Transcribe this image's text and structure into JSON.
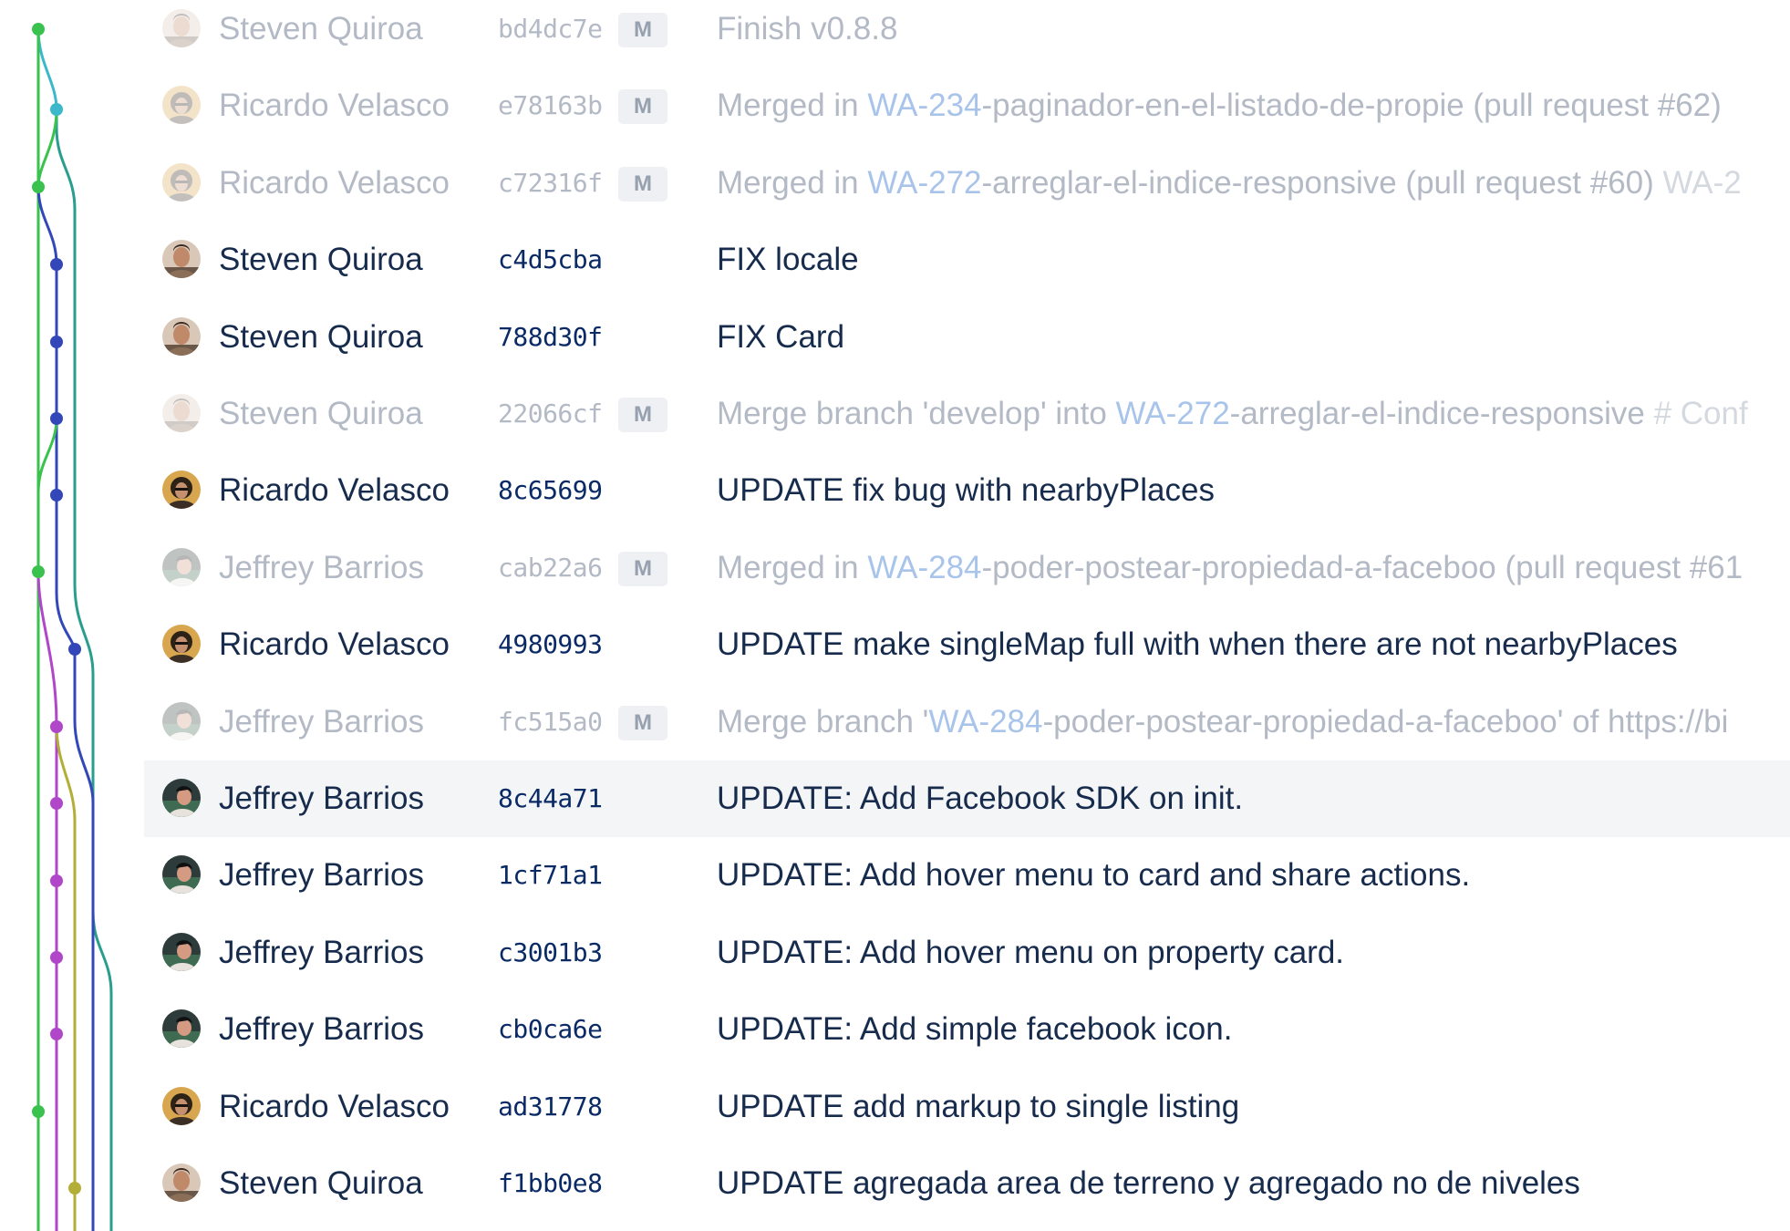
{
  "colors": {
    "lane_green": "#3ac24e",
    "lane_cyan": "#3bb8c9",
    "lane_teal": "#2a9d8f",
    "lane_navy": "#3347b8",
    "lane_magenta": "#b046c8",
    "lane_olive": "#b3ae38",
    "text_primary": "#172b4d",
    "link": "#0052cc"
  },
  "commits": [
    {
      "author": "Steven Quiroa",
      "hash": "bd4dc7e",
      "merge": true,
      "badge": "M",
      "avatar_person": "steven",
      "message": {
        "pre": "Finish v0.8.8",
        "issue": "",
        "post": "",
        "note": ""
      }
    },
    {
      "author": "Ricardo Velasco",
      "hash": "e78163b",
      "merge": true,
      "badge": "M",
      "avatar_person": "ricardo",
      "message": {
        "pre": "Merged in ",
        "issue": "WA-234",
        "post": "-paginador-en-el-listado-de-propie (pull request #62) ",
        "note": ""
      }
    },
    {
      "author": "Ricardo Velasco",
      "hash": "c72316f",
      "merge": true,
      "badge": "M",
      "avatar_person": "ricardo",
      "message": {
        "pre": "Merged in ",
        "issue": "WA-272",
        "post": "-arreglar-el-indice-responsive (pull request #60) ",
        "note": "WA-2"
      }
    },
    {
      "author": "Steven Quiroa",
      "hash": "c4d5cba",
      "merge": false,
      "badge": "",
      "avatar_person": "steven",
      "message": {
        "pre": "FIX locale",
        "issue": "",
        "post": "",
        "note": ""
      }
    },
    {
      "author": "Steven Quiroa",
      "hash": "788d30f",
      "merge": false,
      "badge": "",
      "avatar_person": "steven",
      "message": {
        "pre": "FIX Card",
        "issue": "",
        "post": "",
        "note": ""
      }
    },
    {
      "author": "Steven Quiroa",
      "hash": "22066cf",
      "merge": true,
      "badge": "M",
      "avatar_person": "steven",
      "message": {
        "pre": "Merge branch 'develop' into ",
        "issue": "WA-272",
        "post": "-arreglar-el-indice-responsive ",
        "note": "# Conf"
      }
    },
    {
      "author": "Ricardo Velasco",
      "hash": "8c65699",
      "merge": false,
      "badge": "",
      "avatar_person": "ricardo",
      "message": {
        "pre": "UPDATE fix bug with nearbyPlaces",
        "issue": "",
        "post": "",
        "note": ""
      }
    },
    {
      "author": "Jeffrey Barrios",
      "hash": "cab22a6",
      "merge": true,
      "badge": "M",
      "avatar_person": "jeffrey",
      "message": {
        "pre": "Merged in ",
        "issue": "WA-284",
        "post": "-poder-postear-propiedad-a-faceboo (pull request #61",
        "note": ""
      }
    },
    {
      "author": "Ricardo Velasco",
      "hash": "4980993",
      "merge": false,
      "badge": "",
      "avatar_person": "ricardo",
      "message": {
        "pre": "UPDATE make singleMap full with when there are not nearbyPlaces",
        "issue": "",
        "post": "",
        "note": ""
      }
    },
    {
      "author": "Jeffrey Barrios",
      "hash": "fc515a0",
      "merge": true,
      "badge": "M",
      "avatar_person": "jeffrey",
      "message": {
        "pre": "Merge branch '",
        "issue": "WA-284",
        "post": "-poder-postear-propiedad-a-faceboo' of https://bi",
        "note": ""
      }
    },
    {
      "author": "Jeffrey Barrios",
      "hash": "8c44a71",
      "merge": false,
      "badge": "",
      "avatar_person": "jeffrey",
      "selected": true,
      "message": {
        "pre": "UPDATE: Add Facebook SDK on init.",
        "issue": "",
        "post": "",
        "note": ""
      }
    },
    {
      "author": "Jeffrey Barrios",
      "hash": "1cf71a1",
      "merge": false,
      "badge": "",
      "avatar_person": "jeffrey",
      "message": {
        "pre": "UPDATE: Add hover menu to card and share actions.",
        "issue": "",
        "post": "",
        "note": ""
      }
    },
    {
      "author": "Jeffrey Barrios",
      "hash": "c3001b3",
      "merge": false,
      "badge": "",
      "avatar_person": "jeffrey",
      "message": {
        "pre": "UPDATE: Add hover menu on property card.",
        "issue": "",
        "post": "",
        "note": ""
      }
    },
    {
      "author": "Jeffrey Barrios",
      "hash": "cb0ca6e",
      "merge": false,
      "badge": "",
      "avatar_person": "jeffrey",
      "message": {
        "pre": "UPDATE: Add simple facebook icon.",
        "issue": "",
        "post": "",
        "note": ""
      }
    },
    {
      "author": "Ricardo Velasco",
      "hash": "ad31778",
      "merge": false,
      "badge": "",
      "avatar_person": "ricardo",
      "message": {
        "pre": "UPDATE add markup to single listing",
        "issue": "",
        "post": "",
        "note": ""
      }
    },
    {
      "author": "Steven Quiroa",
      "hash": "f1bb0e8",
      "merge": false,
      "badge": "",
      "avatar_person": "steven",
      "message": {
        "pre": "UPDATE agregada area de terreno y agregado no de niveles",
        "issue": "",
        "post": "",
        "note": ""
      }
    }
  ]
}
